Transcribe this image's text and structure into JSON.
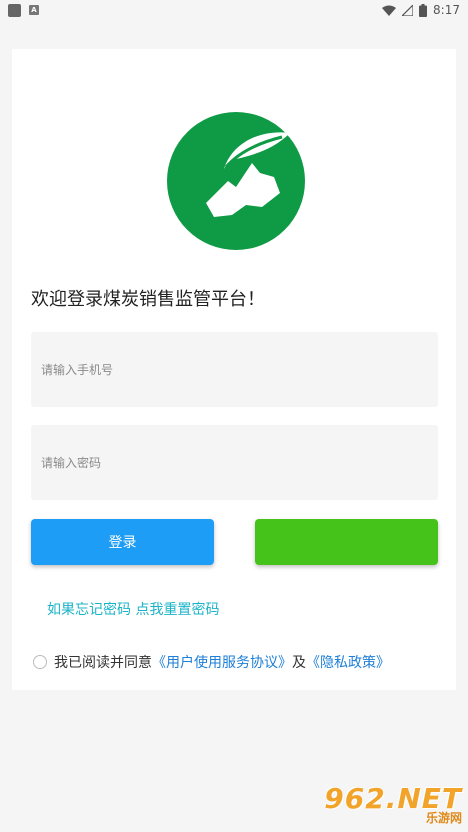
{
  "status_bar": {
    "time": "8:17",
    "notif_letter": "A"
  },
  "logo": {
    "icon": "mountain-leaf-logo",
    "color": "#0f9a45"
  },
  "welcome": "欢迎登录煤炭销售监管平台！",
  "phone": {
    "placeholder": "请输入手机号",
    "value": ""
  },
  "password": {
    "placeholder": "请输入密码",
    "value": ""
  },
  "login_button": {
    "label": "登录",
    "color": "#1e9df6"
  },
  "green_button": {
    "label": "",
    "color": "#46c31a"
  },
  "forgot": {
    "prefix": "如果忘记密码",
    "action": "点我重置密码"
  },
  "agreement": {
    "text": "我已阅读并同意",
    "terms": "《用户使用服务协议》",
    "and": "及",
    "privacy": "《隐私政策》"
  },
  "watermark": {
    "top": "962.NET",
    "bottom": "乐游网"
  }
}
